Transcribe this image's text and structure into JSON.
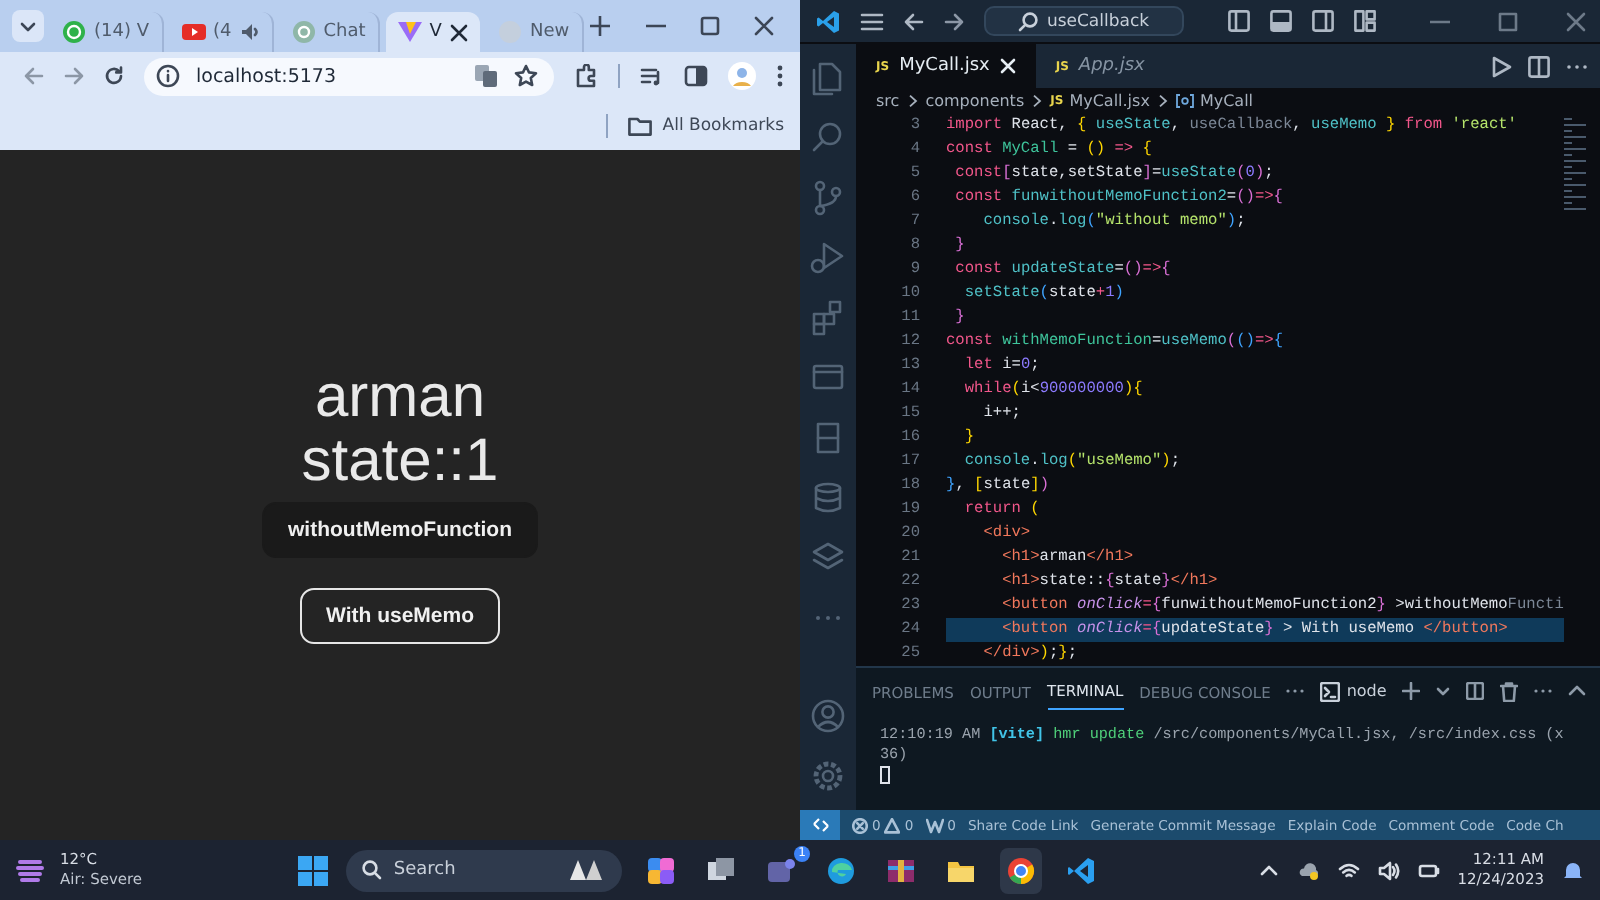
{
  "browser": {
    "tabs": [
      {
        "label": "(14) V",
        "selected": false
      },
      {
        "label": "(4",
        "selected": false
      },
      {
        "label": "Chat",
        "selected": false
      },
      {
        "label": "V",
        "selected": true
      },
      {
        "label": "New",
        "selected": false
      }
    ],
    "address": "localhost:5173",
    "bookmarks_label": "All Bookmarks",
    "page": {
      "headings": [
        "arman",
        "state::1"
      ],
      "buttons": [
        {
          "label": "withoutMemoFunction",
          "kind": "filled"
        },
        {
          "label": "With useMemo",
          "kind": "outlined"
        }
      ]
    }
  },
  "editor": {
    "search": "useCallback",
    "tabs": [
      {
        "badge": "JS",
        "label": "MyCall.jsx",
        "selected": true,
        "preview": false
      },
      {
        "badge": "JS",
        "label": "App.jsx",
        "selected": false,
        "preview": true
      }
    ],
    "breadcrumbs": [
      {
        "kind": "folder",
        "label": "src"
      },
      {
        "kind": "folder",
        "label": "components"
      },
      {
        "kind": "file",
        "badge": "JS",
        "label": "MyCall.jsx"
      },
      {
        "kind": "symbol",
        "label": "MyCall"
      }
    ],
    "lines": [
      {
        "number": "3",
        "current": false,
        "tokens": [
          {
            "kind": "kw",
            "text": "import "
          },
          {
            "kind": "tx",
            "text": "React, "
          },
          {
            "kind": "b1",
            "text": "{"
          },
          {
            "kind": "fn",
            "text": " useState"
          },
          {
            "kind": "tx",
            "text": ", "
          },
          {
            "kind": "dim",
            "text": "useCallback"
          },
          {
            "kind": "tx",
            "text": ", "
          },
          {
            "kind": "fn",
            "text": "useMemo"
          },
          {
            "kind": "b1",
            "text": " }"
          },
          {
            "kind": "kw",
            "text": " from "
          },
          {
            "kind": "str",
            "text": "'react'"
          }
        ]
      },
      {
        "number": "4",
        "current": false,
        "tokens": [
          {
            "kind": "kw",
            "text": "const "
          },
          {
            "kind": "name",
            "text": "MyCall"
          },
          {
            "kind": "tx",
            "text": " = "
          },
          {
            "kind": "b1",
            "text": "()"
          },
          {
            "kind": "op",
            "text": " => "
          },
          {
            "kind": "b1",
            "text": "{"
          }
        ]
      },
      {
        "number": "5",
        "current": false,
        "tokens": [
          {
            "kind": "kw",
            "text": " const"
          },
          {
            "kind": "b2",
            "text": "["
          },
          {
            "kind": "tx",
            "text": "state,setState"
          },
          {
            "kind": "b2",
            "text": "]"
          },
          {
            "kind": "tx",
            "text": "="
          },
          {
            "kind": "fn",
            "text": "useState"
          },
          {
            "kind": "b2",
            "text": "("
          },
          {
            "kind": "num",
            "text": "0"
          },
          {
            "kind": "b2",
            "text": ")"
          },
          {
            "kind": "tx",
            "text": ";"
          }
        ]
      },
      {
        "number": "6",
        "current": false,
        "tokens": [
          {
            "kind": "kw",
            "text": " const "
          },
          {
            "kind": "fn",
            "text": "funwithoutMemoFunction2"
          },
          {
            "kind": "tx",
            "text": "="
          },
          {
            "kind": "b2",
            "text": "()"
          },
          {
            "kind": "op",
            "text": "=>"
          },
          {
            "kind": "b2",
            "text": "{"
          }
        ]
      },
      {
        "number": "7",
        "current": false,
        "tokens": [
          {
            "kind": "fn",
            "text": "    console"
          },
          {
            "kind": "tx",
            "text": "."
          },
          {
            "kind": "fn",
            "text": "log"
          },
          {
            "kind": "b3",
            "text": "("
          },
          {
            "kind": "str",
            "text": "\"without memo\""
          },
          {
            "kind": "b3",
            "text": ")"
          },
          {
            "kind": "tx",
            "text": ";"
          }
        ]
      },
      {
        "number": "8",
        "current": false,
        "tokens": [
          {
            "kind": "b2",
            "text": " }"
          }
        ]
      },
      {
        "number": "9",
        "current": false,
        "tokens": [
          {
            "kind": "kw",
            "text": " const "
          },
          {
            "kind": "fn",
            "text": "updateState"
          },
          {
            "kind": "tx",
            "text": "="
          },
          {
            "kind": "b2",
            "text": "()"
          },
          {
            "kind": "op",
            "text": "=>"
          },
          {
            "kind": "b2",
            "text": "{"
          }
        ]
      },
      {
        "number": "10",
        "current": false,
        "tokens": [
          {
            "kind": "fn",
            "text": "  setState"
          },
          {
            "kind": "b3",
            "text": "("
          },
          {
            "kind": "tx",
            "text": "state"
          },
          {
            "kind": "op",
            "text": "+"
          },
          {
            "kind": "num",
            "text": "1"
          },
          {
            "kind": "b3",
            "text": ")"
          }
        ]
      },
      {
        "number": "11",
        "current": false,
        "tokens": [
          {
            "kind": "b2",
            "text": " }"
          }
        ]
      },
      {
        "number": "12",
        "current": false,
        "tokens": [
          {
            "kind": "kw",
            "text": "const "
          },
          {
            "kind": "name",
            "text": "withMemoFunction"
          },
          {
            "kind": "tx",
            "text": "="
          },
          {
            "kind": "fn",
            "text": "useMemo"
          },
          {
            "kind": "b2",
            "text": "("
          },
          {
            "kind": "b3",
            "text": "()"
          },
          {
            "kind": "op",
            "text": "=>"
          },
          {
            "kind": "b3",
            "text": "{"
          }
        ]
      },
      {
        "number": "13",
        "current": false,
        "tokens": [
          {
            "kind": "kw",
            "text": "  let "
          },
          {
            "kind": "tx",
            "text": "i="
          },
          {
            "kind": "num",
            "text": "0"
          },
          {
            "kind": "tx",
            "text": ";"
          }
        ]
      },
      {
        "number": "14",
        "current": false,
        "tokens": [
          {
            "kind": "kw",
            "text": "  while"
          },
          {
            "kind": "b1",
            "text": "("
          },
          {
            "kind": "tx",
            "text": "i<"
          },
          {
            "kind": "num",
            "text": "900000000"
          },
          {
            "kind": "b1",
            "text": "){"
          }
        ]
      },
      {
        "number": "15",
        "current": false,
        "tokens": [
          {
            "kind": "tx",
            "text": "    i++;"
          }
        ]
      },
      {
        "number": "16",
        "current": false,
        "tokens": [
          {
            "kind": "b1",
            "text": "  }"
          }
        ]
      },
      {
        "number": "17",
        "current": false,
        "tokens": [
          {
            "kind": "fn",
            "text": "  console"
          },
          {
            "kind": "tx",
            "text": "."
          },
          {
            "kind": "fn",
            "text": "log"
          },
          {
            "kind": "b1",
            "text": "("
          },
          {
            "kind": "str",
            "text": "\"useMemo\""
          },
          {
            "kind": "b1",
            "text": ")"
          },
          {
            "kind": "tx",
            "text": ";"
          }
        ]
      },
      {
        "number": "18",
        "current": false,
        "tokens": [
          {
            "kind": "b3",
            "text": "}"
          },
          {
            "kind": "tx",
            "text": ", "
          },
          {
            "kind": "b1",
            "text": "["
          },
          {
            "kind": "tx",
            "text": "state"
          },
          {
            "kind": "b1",
            "text": "]"
          },
          {
            "kind": "b2",
            "text": ")"
          }
        ]
      },
      {
        "number": "19",
        "current": false,
        "tokens": [
          {
            "kind": "kw",
            "text": "  return "
          },
          {
            "kind": "b1",
            "text": "("
          }
        ]
      },
      {
        "number": "20",
        "current": false,
        "tokens": [
          {
            "kind": "tag",
            "text": "    <div>"
          }
        ]
      },
      {
        "number": "21",
        "current": false,
        "tokens": [
          {
            "kind": "tag",
            "text": "      <h1>"
          },
          {
            "kind": "tx",
            "text": "arman"
          },
          {
            "kind": "tag",
            "text": "</h1>"
          }
        ]
      },
      {
        "number": "22",
        "current": false,
        "tokens": [
          {
            "kind": "tag",
            "text": "      <h1>"
          },
          {
            "kind": "tx",
            "text": "state::"
          },
          {
            "kind": "b2",
            "text": "{"
          },
          {
            "kind": "tx",
            "text": "state"
          },
          {
            "kind": "b2",
            "text": "}"
          },
          {
            "kind": "tag",
            "text": "</h1>"
          }
        ]
      },
      {
        "number": "23",
        "current": false,
        "tokens": [
          {
            "kind": "tag",
            "text": "      <button "
          },
          {
            "kind": "attr",
            "text": "onClick"
          },
          {
            "kind": "op",
            "text": "="
          },
          {
            "kind": "b2",
            "text": "{"
          },
          {
            "kind": "tx",
            "text": "funwithoutMemoFunction2"
          },
          {
            "kind": "b2",
            "text": "}"
          },
          {
            "kind": "tx",
            "text": " >withoutMemo"
          },
          {
            "kind": "dim",
            "text": "Functi"
          }
        ]
      },
      {
        "number": "24",
        "current": true,
        "tokens": [
          {
            "kind": "tag",
            "text": "      <button "
          },
          {
            "kind": "attr",
            "text": "onClick"
          },
          {
            "kind": "op",
            "text": "="
          },
          {
            "kind": "b2",
            "text": "{"
          },
          {
            "kind": "tx",
            "text": "updateState"
          },
          {
            "kind": "b2",
            "text": "}"
          },
          {
            "kind": "tx",
            "text": " > With useMemo "
          },
          {
            "kind": "tag",
            "text": "</button>"
          }
        ]
      },
      {
        "number": "25",
        "current": false,
        "tokens": [
          {
            "kind": "tag",
            "text": "    </div>"
          },
          {
            "kind": "b1",
            "text": ")"
          },
          {
            "kind": "tx",
            "text": ";"
          },
          {
            "kind": "b1",
            "text": "}"
          },
          {
            "kind": "tx",
            "text": ";"
          }
        ]
      }
    ],
    "panel_tabs": [
      {
        "label": "PROBLEMS",
        "selected": false
      },
      {
        "label": "OUTPUT",
        "selected": false
      },
      {
        "label": "TERMINAL",
        "selected": true
      },
      {
        "label": "DEBUG CONSOLE",
        "selected": false
      }
    ],
    "terminal_profile": "node",
    "terminal_lines": [
      [
        {
          "kind": "time",
          "text": "12:10:19 AM "
        },
        {
          "kind": "vite",
          "text": "[vite]"
        },
        {
          "kind": "hmr",
          "text": " hmr update"
        },
        {
          "kind": "path",
          "text": " /src/components/MyCall.jsx, /src/index.css (x"
        }
      ],
      [
        {
          "kind": "path",
          "text": "36)"
        }
      ]
    ],
    "status": {
      "errors": "0",
      "warnings": "0",
      "ports": "0",
      "actions": [
        "Share Code Link",
        "Generate Commit Message",
        "Explain Code",
        "Comment Code",
        "Code Ch"
      ]
    }
  },
  "taskbar": {
    "temperature": "12°C",
    "air_quality": "Air: Severe",
    "search_placeholder": "Search",
    "teams_badge": "1",
    "time": "12:11 AM",
    "date": "12/24/2023"
  }
}
